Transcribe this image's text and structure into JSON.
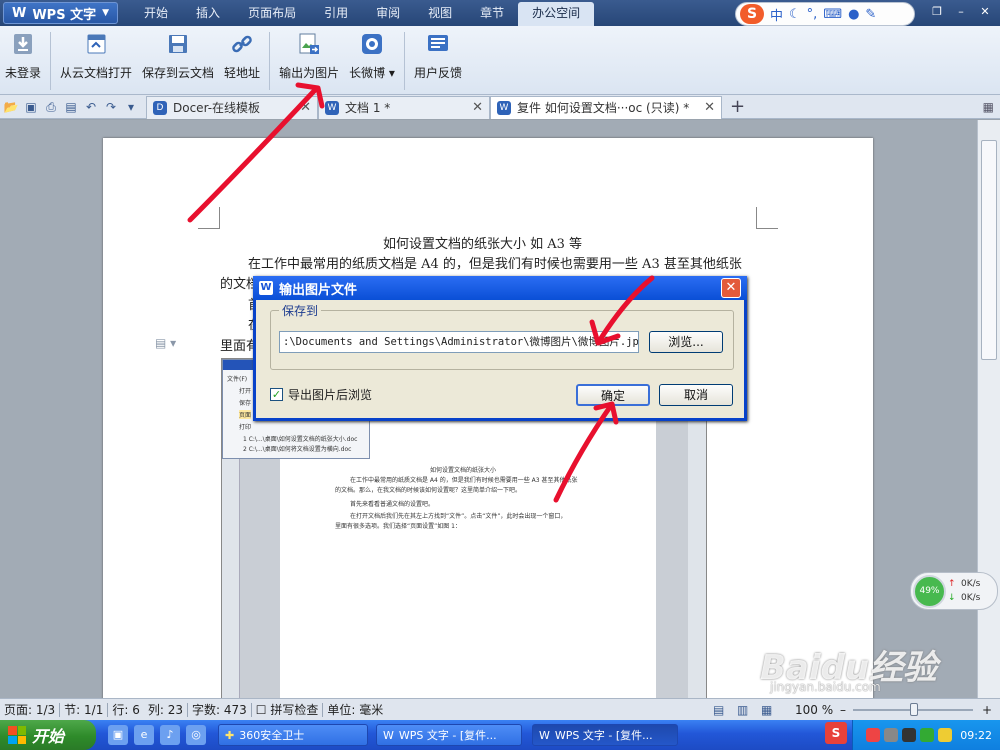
{
  "menubar": {
    "app_title": "WPS 文字",
    "tabs": [
      "开始",
      "插入",
      "页面布局",
      "引用",
      "审阅",
      "视图",
      "章节",
      "办公空间"
    ],
    "active_tab": "办公空间",
    "ime": "中"
  },
  "ribbon": {
    "login": "未登录",
    "open_cloud": "从云文档打开",
    "save_cloud": "保存到云文档",
    "short_url": "轻地址",
    "export_image": "输出为图片",
    "long_weibo": "长微博",
    "feedback": "用户反馈"
  },
  "doc_tabs": [
    {
      "label": "Docer-在线模板"
    },
    {
      "label": "文档 1 *"
    },
    {
      "label": "复件 如何设置文档···oc (只读) *"
    }
  ],
  "document": {
    "title": "如何设置文档的纸张大小 如 A3 等",
    "line1": "在工作中最常用的纸质文档是 A4 的，但是我们有时候也需要用一些 A3 甚至其他纸张",
    "line2": "的文档",
    "line3": "首",
    "line4": "在",
    "line5": "里面有"
  },
  "embedded": {
    "title": "如何设置文档的纸张大小",
    "para1": "在工作中最常用的纸质文档是 A4 的，但是我们有时候也需要用一些 A3 甚至其他纸张",
    "para2": "的文档。那么，在我文档的时候该如何设置呢？这里简单介绍一下吧。",
    "para3": "首先来看看普通文档的设置吧。",
    "para4": "在打开文档后我们先在其左上方找到“文件”。点击“文件”，此时会出现一个窗口，",
    "para5": "里面有很多选项。我们选择“页面设置”如图 1：",
    "menu_items": [
      "文件(F)",
      "打开",
      "保存",
      "页面",
      "打印",
      "1 C:\\...\\桌面\\如何设置文档的纸张大小.doc",
      "2 C:\\...\\桌面\\如何将文档设置为横向.doc"
    ]
  },
  "dialog": {
    "title": "输出图片文件",
    "group_label": "保存到",
    "path": ":\\Documents and Settings\\Administrator\\微博图片\\微博图片.jpg",
    "browse": "浏览...",
    "checkbox_label": "导出图片后浏览",
    "checkbox_checked": true,
    "ok": "确定",
    "cancel": "取消"
  },
  "statusbar": {
    "page": "页面: 1/3",
    "section": "节: 1/1",
    "row": "行: 6",
    "col": "列: 23",
    "words": "字数: 473",
    "spell": "拼写检查",
    "unit": "单位: 毫米",
    "zoom": "100 %"
  },
  "netwidget": {
    "percent": "49%",
    "up": "0K/s",
    "down": "0K/s"
  },
  "taskbar": {
    "start": "开始",
    "tasks": [
      "360安全卫士",
      "WPS 文字 - [复件...",
      "WPS 文字 - [复件..."
    ],
    "clock": "09:22"
  },
  "watermark": {
    "logo": "Baidu经验",
    "url": "jingyan.baidu.com"
  },
  "colors": {
    "annotation": "#e8102e",
    "taskbar": "#2257d8",
    "dialog_title": "#0a4fd6"
  }
}
